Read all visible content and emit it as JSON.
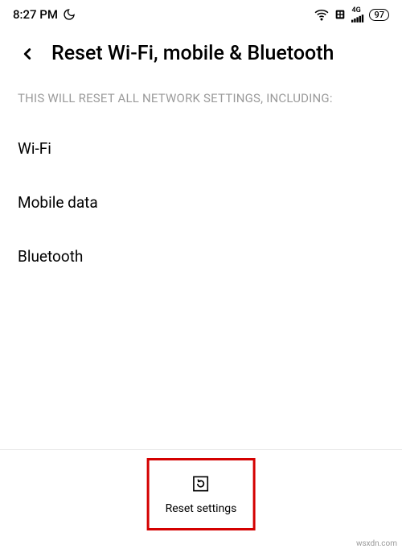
{
  "status_bar": {
    "time": "8:27 PM",
    "battery": "97",
    "signal_label": "4G"
  },
  "header": {
    "title": "Reset Wi-Fi, mobile & Bluetooth"
  },
  "subheader": "THIS WILL RESET ALL NETWORK SETTINGS, INCLUDING:",
  "items": {
    "wifi": "Wi-Fi",
    "mobile_data": "Mobile data",
    "bluetooth": "Bluetooth"
  },
  "reset_button": {
    "label": "Reset settings"
  },
  "watermark": "wsxdn.com"
}
